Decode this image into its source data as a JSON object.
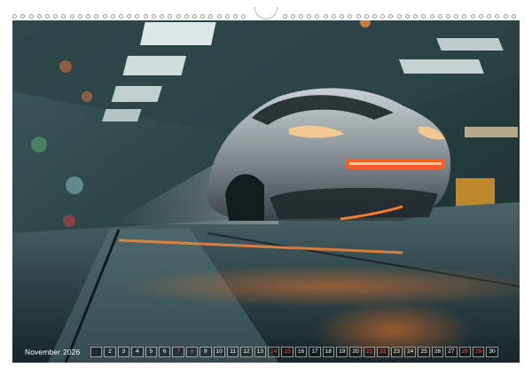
{
  "calendar": {
    "month": "November",
    "year": "2026",
    "days": [
      "",
      "2",
      "3",
      "4",
      "5",
      "6",
      "7",
      "8",
      "9",
      "10",
      "11",
      "12",
      "13",
      "14",
      "15",
      "16",
      "17",
      "18",
      "19",
      "20",
      "21",
      "22",
      "23",
      "24",
      "25",
      "26",
      "27",
      "28",
      "29",
      "30"
    ],
    "weekend_days": [
      "7",
      "8",
      "14",
      "15",
      "21",
      "22",
      "28",
      "29"
    ]
  },
  "colors": {
    "weekend": "#ff4a3a",
    "text": "#ffffff",
    "accent_light": "#ff6a2a"
  }
}
